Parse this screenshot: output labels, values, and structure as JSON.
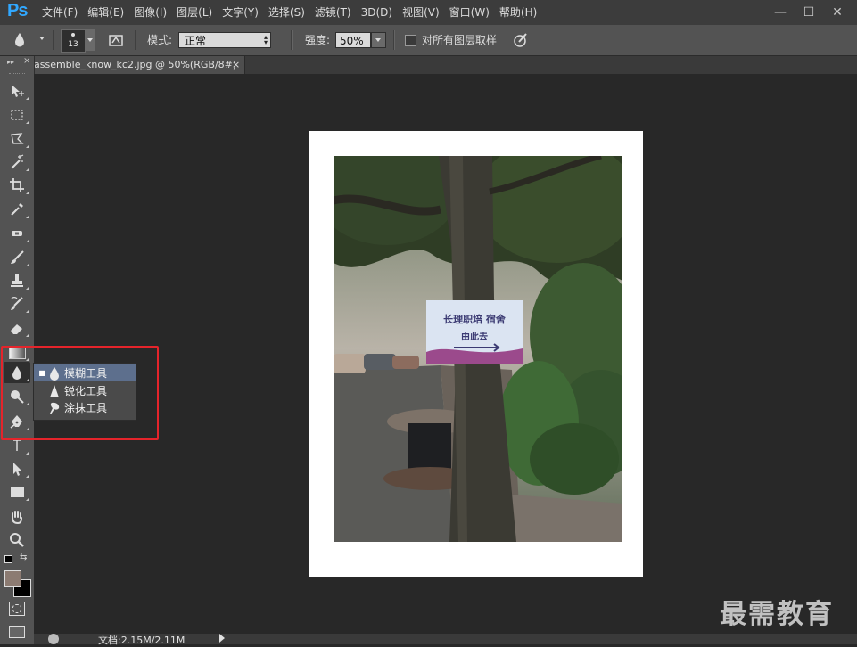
{
  "app": {
    "logo": "Ps"
  },
  "menubar": {
    "items": [
      "文件(F)",
      "编辑(E)",
      "图像(I)",
      "图层(L)",
      "文字(Y)",
      "选择(S)",
      "滤镜(T)",
      "3D(D)",
      "视图(V)",
      "窗口(W)",
      "帮助(H)"
    ],
    "window_controls": {
      "minimize": "—",
      "maximize": "☐",
      "close": "✕"
    }
  },
  "options": {
    "brush_size": "13",
    "mode_label": "模式:",
    "mode_value": "正常",
    "strength_label": "强度:",
    "strength_value": "50%",
    "sample_all_layers_label": "对所有图层取样",
    "sample_all_layers_checked": false
  },
  "document": {
    "tab_title": "assemble_know_kc2.jpg @ 50%(RGB/8#)",
    "tab_close": "×"
  },
  "photo": {
    "sign_line1": "长理职培  宿舍",
    "sign_line2": "由此去"
  },
  "flyout": {
    "items": [
      {
        "label": "模糊工具",
        "icon": "blur-drop-icon",
        "selected": true
      },
      {
        "label": "锐化工具",
        "icon": "sharpen-triangle-icon",
        "selected": false
      },
      {
        "label": "涂抹工具",
        "icon": "smudge-finger-icon",
        "selected": false
      }
    ]
  },
  "statusbar": {
    "doc_size": "文档:2.15M/2.11M"
  },
  "watermark": "最需教育",
  "colors": {
    "accent": "#31a8ff",
    "highlight_red": "#e5242b",
    "flyout_selected": "#5d6f8d",
    "foreground_swatch": "#8c7b72",
    "background_swatch": "#000000"
  }
}
